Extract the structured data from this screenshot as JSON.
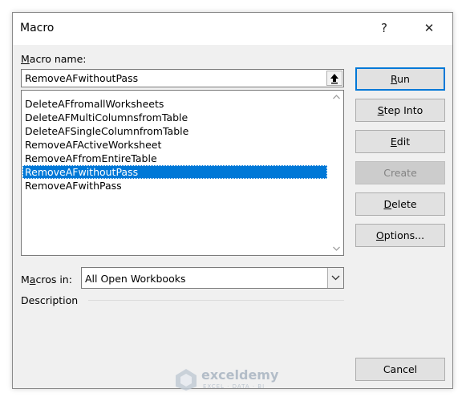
{
  "window": {
    "title": "Macro",
    "help_glyph": "?",
    "close_glyph": "✕"
  },
  "macro_name": {
    "label_prefix": "",
    "label_access": "M",
    "label_rest": "acro name:",
    "value": "RemoveAFwithoutPass",
    "upload_icon": "arrow-up-icon"
  },
  "macro_list": {
    "items": [
      {
        "label": "DeleteAFfromallWorksheets",
        "selected": false
      },
      {
        "label": "DeleteAFMultiColumnsfromTable",
        "selected": false
      },
      {
        "label": "DeleteAFSingleColumnfromTable",
        "selected": false
      },
      {
        "label": "RemoveAFActiveWorksheet",
        "selected": false
      },
      {
        "label": "RemoveAFfromEntireTable",
        "selected": false
      },
      {
        "label": "RemoveAFwithoutPass",
        "selected": true
      },
      {
        "label": "RemoveAFwithPass",
        "selected": false
      }
    ]
  },
  "macros_in": {
    "label_prefix": "M",
    "label_access": "a",
    "label_rest": "cros in:",
    "value": "All Open Workbooks"
  },
  "description": {
    "label": "Description"
  },
  "buttons": {
    "run": {
      "pre": "",
      "key": "R",
      "post": "un"
    },
    "step_into": {
      "pre": "",
      "key": "S",
      "post": "tep Into"
    },
    "edit": {
      "pre": "",
      "key": "E",
      "post": "dit"
    },
    "create": {
      "pre": "",
      "key": "",
      "post": "Create"
    },
    "delete": {
      "pre": "",
      "key": "D",
      "post": "elete"
    },
    "options": {
      "pre": "",
      "key": "O",
      "post": "ptions..."
    },
    "cancel": {
      "pre": "",
      "key": "",
      "post": "Cancel"
    }
  },
  "watermark": {
    "name": "exceldemy",
    "tagline": "EXCEL · DATA · BI"
  },
  "colors": {
    "selection": "#0078d7",
    "default_button_border": "#0078d7",
    "dialog_bg": "#f0f0f0"
  }
}
